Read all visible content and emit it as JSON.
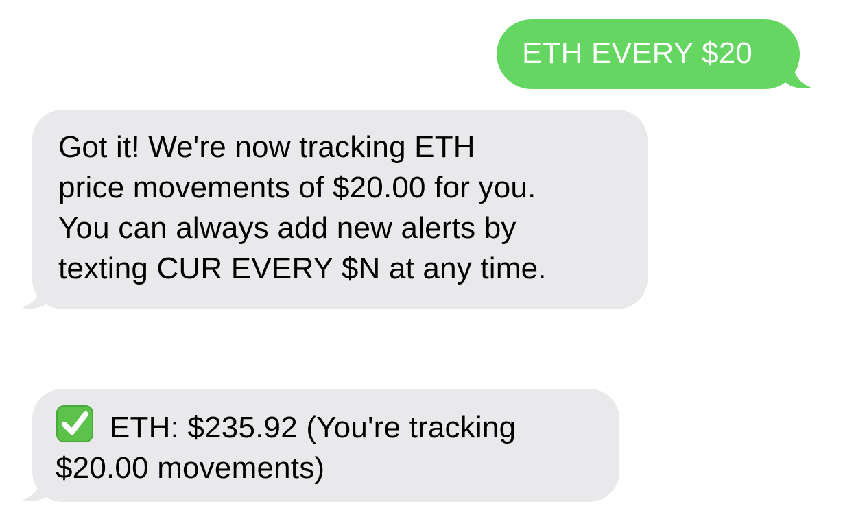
{
  "thread": {
    "messages": [
      {
        "direction": "sent",
        "text": "ETH EVERY $20",
        "bubble_color": "#65d661",
        "text_color": "#ffffff"
      },
      {
        "direction": "received",
        "text": "Got it! We're now tracking ETH\nprice movements of $20.00 for you.\nYou can always add new alerts by\ntexting CUR EVERY $N at any time.",
        "bubble_color": "#e9e9eb",
        "text_color": "#000000"
      },
      {
        "direction": "received",
        "icon": "check-mark-button-icon",
        "text": "ETH: $235.92 (You're tracking\n$20.00 movements)",
        "bubble_color": "#e9e9eb",
        "text_color": "#000000"
      }
    ]
  }
}
